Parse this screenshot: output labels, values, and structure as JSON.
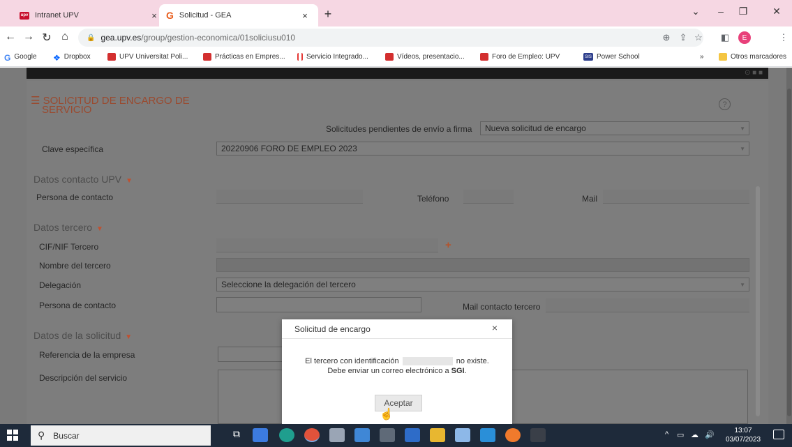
{
  "browser": {
    "tabs": [
      {
        "label": "Intranet UPV",
        "favicon": "upv",
        "active": false
      },
      {
        "label": "Solicitud - GEA",
        "favicon": "G",
        "active": true
      }
    ],
    "new_tab": "+",
    "url_host": "gea.upv.es",
    "url_path": "/group/gestion-economica/01soliciusu010",
    "profile_initial": "E",
    "bookmarks": [
      {
        "label": "Google",
        "icon": "google"
      },
      {
        "label": "Dropbox",
        "icon": "dropbox"
      },
      {
        "label": "UPV Universitat Poli...",
        "icon": "red"
      },
      {
        "label": "Prácticas en Empres...",
        "icon": "red"
      },
      {
        "label": "Servicio Integrado...",
        "icon": "bars"
      },
      {
        "label": "Vídeos, presentacio...",
        "icon": "red"
      },
      {
        "label": "Foro de Empleo: UPV",
        "icon": "red"
      },
      {
        "label": "Power School",
        "icon": "sis"
      }
    ],
    "more_bookmarks": "»",
    "other_bookmarks": "Otros marcadores"
  },
  "page": {
    "title_line1": "SOLICITUD DE ENCARGO DE",
    "title_line2": "SERVICIO",
    "pending_label": "Solicitudes pendientes de envío a firma",
    "pending_value": "Nueva solicitud de encargo",
    "clave_label": "Clave específica",
    "clave_value": "20220906 FORO DE EMPLEO 2023",
    "section_contacto": "Datos contacto UPV",
    "persona_label": "Persona de contacto",
    "telefono_label": "Teléfono",
    "mail_label": "Mail",
    "section_tercero": "Datos tercero",
    "cif_label": "CIF/NIF Tercero",
    "nombre_label": "Nombre del tercero",
    "delegacion_label": "Delegación",
    "delegacion_value": "Seleccione la delegación del tercero",
    "persona_tercero_label": "Persona de contacto",
    "mail_tercero_label": "Mail contacto tercero",
    "section_solicitud": "Datos de la solicitud",
    "referencia_label": "Referencia de la empresa",
    "descripcion_label": "Descripción del servicio"
  },
  "dialog": {
    "title": "Solicitud de encargo",
    "close": "×",
    "msg_part1": "El tercero con identificación",
    "msg_part2": "no existe.",
    "msg_line2_part1": "Debe enviar un correo electrónico a",
    "msg_line2_bold": "SGI",
    "msg_line2_end": ".",
    "accept": "Aceptar"
  },
  "taskbar": {
    "search_label": "Buscar",
    "time": "13:07",
    "date": "03/07/2023"
  },
  "colors": {
    "tabbar": "#f6d7e3",
    "title_accent": "#9a4a2f",
    "taskbar": "#1e2a3a"
  }
}
